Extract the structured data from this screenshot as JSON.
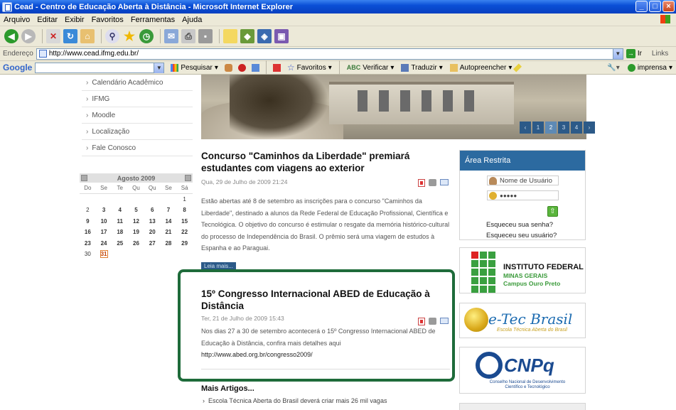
{
  "window": {
    "title": "Cead - Centro de Educação Aberta à Distância - Microsoft Internet Explorer"
  },
  "menu": [
    "Arquivo",
    "Editar",
    "Exibir",
    "Favoritos",
    "Ferramentas",
    "Ajuda"
  ],
  "address": {
    "label": "Endereço",
    "url": "http://www.cead.ifmg.edu.br/",
    "go": "Ir",
    "links": "Links"
  },
  "google": {
    "logo": "Google",
    "search": "Pesquisar",
    "favorites": "Favoritos",
    "check": "Verificar",
    "translate": "Traduzir",
    "autofill": "Autopreencher",
    "print": "imprensa"
  },
  "nav": [
    "Calendário Acadêmico",
    "IFMG",
    "Moodle",
    "Localização",
    "Fale Conosco"
  ],
  "calendar": {
    "month": "Agosto 2009",
    "days": [
      "Do",
      "Se",
      "Te",
      "Qu",
      "Qu",
      "Se",
      "Sá"
    ],
    "weeks": [
      [
        "",
        "",
        "",
        "",
        "",
        "",
        "1"
      ],
      [
        "2",
        "3",
        "4",
        "5",
        "6",
        "7",
        "8"
      ],
      [
        "9",
        "10",
        "11",
        "12",
        "13",
        "14",
        "15"
      ],
      [
        "16",
        "17",
        "18",
        "19",
        "20",
        "21",
        "22"
      ],
      [
        "23",
        "24",
        "25",
        "26",
        "27",
        "28",
        "29"
      ],
      [
        "30",
        "31",
        "",
        "",
        "",
        "",
        ""
      ]
    ],
    "today": "31"
  },
  "banner": {
    "pages": [
      "‹",
      "1",
      "2",
      "3",
      "4",
      "›"
    ],
    "active": "2"
  },
  "article1": {
    "title": "Concurso \"Caminhos da Liberdade\" premiará estudantes com viagens ao exterior",
    "date": "Qua, 29 de Julho de 2009 21:24",
    "body": "Estão abertas até 8 de setembro as inscrições para o concurso \"Caminhos da Liberdade\", destinado a alunos da Rede Federal de Educação Profissional, Científica e Tecnológica. O objetivo do concurso é estimular o resgate da memória histórico-cultural do processo de Independência do Brasil. O prêmio será uma viagem de estudos à Espanha e ao Paraguai.",
    "readmore": "Leia mais..."
  },
  "article2": {
    "title": "15º Congresso Internacional ABED de Educação à Distância",
    "date": "Ter, 21 de Julho de 2009 15:43",
    "body": "Nos dias 27 a 30 de setembro acontecerá o 15º Congresso Internacional ABED de Educação à Distância, confira mais detalhes aqui",
    "link": "http://www.abed.org.br/congresso2009/"
  },
  "more": {
    "heading": "Mais Artigos...",
    "items": [
      "Escola Técnica Aberta do Brasil deverá criar mais 26 mil vagas"
    ]
  },
  "login": {
    "heading": "Área Restrita",
    "username_placeholder": "Nome de Usuário",
    "password": "●●●●●",
    "forgot_password": "Esqueceu sua senha?",
    "forgot_user": "Esqueceu seu usuário?"
  },
  "sponsors": {
    "ifmg": [
      "INSTITUTO FEDERAL",
      "MINAS GERAIS",
      "Campus Ouro Preto"
    ],
    "etec": [
      "e-Tec Brasil",
      "Escola Técnica Aberta do Brasil"
    ],
    "cnpq": [
      "CNPq",
      "Conselho Nacional de Desenvolvimento Científico e Tecnológico"
    ]
  }
}
